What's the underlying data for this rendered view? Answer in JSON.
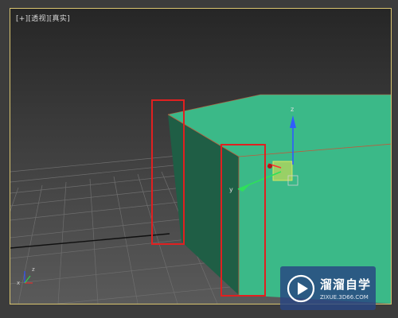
{
  "viewport": {
    "label_plus": "[+]",
    "label_view": "[透视]",
    "label_shading": "[真实]",
    "border_color": "#d9c470"
  },
  "scene": {
    "box_color": "#3bb988",
    "box_side_color": "#1f5e45",
    "highlight_color": "#e02020",
    "axis_labels": {
      "x": "x",
      "y": "y",
      "z": "z"
    }
  },
  "watermark": {
    "brand": "溜溜自学",
    "url": "ZIXUE.3D66.COM",
    "bg_color": "#28468a"
  }
}
